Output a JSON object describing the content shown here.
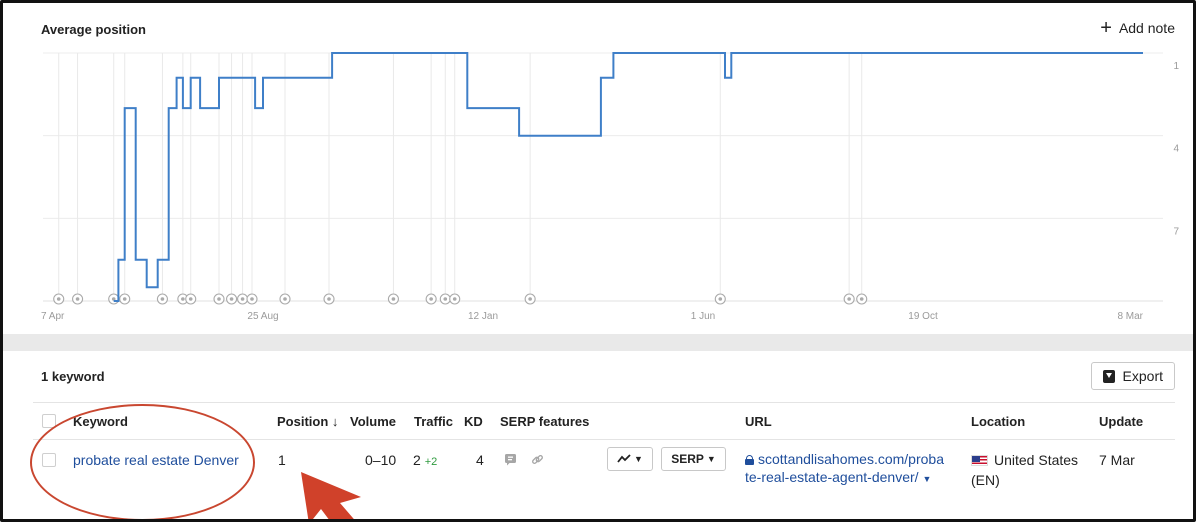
{
  "chart_panel": {
    "title": "Average position",
    "add_note_label": "Add note"
  },
  "chart_data": {
    "type": "line",
    "title": "Average position",
    "ylabel": "",
    "y_inverted": true,
    "yticks": [
      "1",
      "4",
      "7"
    ],
    "ylim": [
      1,
      10
    ],
    "xticks": [
      "7 Apr",
      "25 Aug",
      "12 Jan",
      "1 Jun",
      "19 Oct",
      "8 Mar"
    ],
    "grid": "horizontal",
    "series": [
      {
        "color": "#3f7fc8",
        "points": [
          [
            "2021-05-22",
            10
          ],
          [
            "2021-05-25",
            8.5
          ],
          [
            "2021-05-29",
            3
          ],
          [
            "2021-06-05",
            8.5
          ],
          [
            "2021-06-12",
            9.5
          ],
          [
            "2021-06-19",
            8.5
          ],
          [
            "2021-06-26",
            3
          ],
          [
            "2021-07-01",
            1.9
          ],
          [
            "2021-07-05",
            3
          ],
          [
            "2021-07-10",
            1.9
          ],
          [
            "2021-07-16",
            3
          ],
          [
            "2021-07-28",
            1.9
          ],
          [
            "2021-08-20",
            3
          ],
          [
            "2021-08-25",
            1.9
          ],
          [
            "2021-10-08",
            1
          ],
          [
            "2022-01-02",
            3
          ],
          [
            "2022-02-04",
            4
          ],
          [
            "2022-03-28",
            1.9
          ],
          [
            "2022-04-05",
            1
          ],
          [
            "2022-06-15",
            1.9
          ],
          [
            "2022-06-19",
            1
          ],
          [
            "2023-03-08",
            1
          ]
        ]
      }
    ],
    "annotation_markers": 22
  },
  "table_panel": {
    "keyword_count": "1 keyword",
    "export_label": "Export",
    "columns": {
      "keyword": "Keyword",
      "position": "Position ↓",
      "volume": "Volume",
      "traffic": "Traffic",
      "kd": "KD",
      "serp_features": "SERP features",
      "url": "URL",
      "location": "Location",
      "update": "Update"
    },
    "rows": [
      {
        "keyword": "probate real estate Denver",
        "position": "1",
        "volume": "0–10",
        "traffic": "2",
        "traffic_delta": "+2",
        "kd": "4",
        "serp_button": "SERP",
        "url_line1": "scottandlisahomes.com/proba",
        "url_line2": "te-real-estate-agent-denver/",
        "location": "United States",
        "location_lang": "(EN)",
        "update": "7 Mar"
      }
    ]
  },
  "colors": {
    "line": "#3f7fc8",
    "link": "#1f4e9c",
    "annotation": "#c94730",
    "positive": "#2e9a3e"
  },
  "icons": [
    "plus-icon",
    "export-icon",
    "trend-chart-icon",
    "caret-down-icon",
    "featured-snippet-icon",
    "link-icon",
    "lock-icon",
    "us-flag-icon",
    "note-marker-icon"
  ]
}
